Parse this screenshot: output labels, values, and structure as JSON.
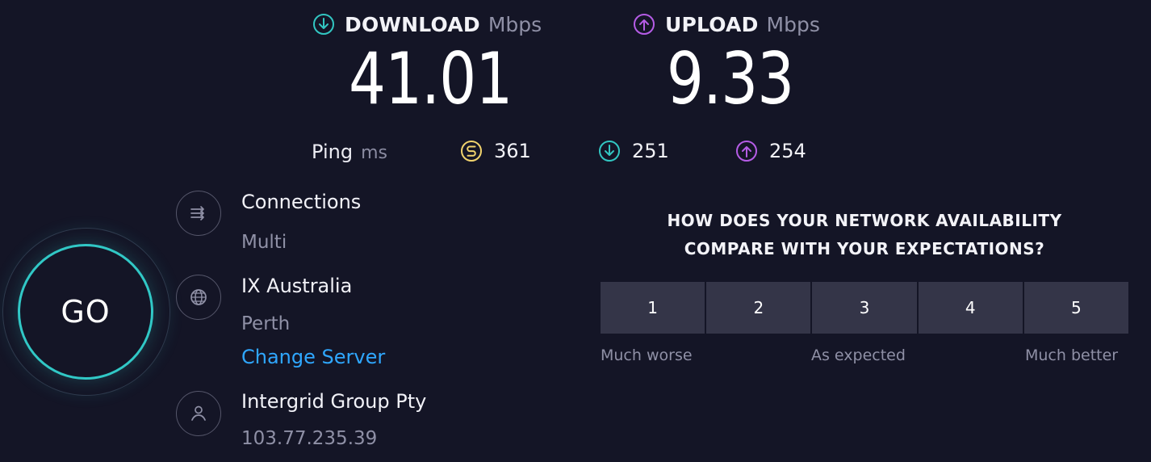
{
  "speed": {
    "download": {
      "label": "DOWNLOAD",
      "unit": "Mbps",
      "value": "41.01",
      "icon": "download-arrow-circle-icon",
      "color": "#32c6c2"
    },
    "upload": {
      "label": "UPLOAD",
      "unit": "Mbps",
      "value": "9.33",
      "icon": "upload-arrow-circle-icon",
      "color": "#b55ce6"
    }
  },
  "ping": {
    "label": "Ping",
    "unit": "ms",
    "idle": {
      "value": "361",
      "icon": "ping-idle-icon",
      "color": "#f1d36d"
    },
    "download": {
      "value": "251",
      "icon": "download-arrow-circle-icon",
      "color": "#32c6c2"
    },
    "upload": {
      "value": "254",
      "icon": "upload-arrow-circle-icon",
      "color": "#b55ce6"
    }
  },
  "go_button": {
    "label": "GO",
    "color": "#31c8c6"
  },
  "connections": {
    "title": "Connections",
    "value": "Multi",
    "icon": "connections-icon"
  },
  "server": {
    "title": "IX Australia",
    "location": "Perth",
    "change_label": "Change Server",
    "icon": "globe-icon",
    "link_color": "#2fa7ff"
  },
  "provider": {
    "name": "Intergrid Group Pty",
    "ip": "103.77.235.39",
    "icon": "user-icon"
  },
  "survey": {
    "question_line1": "HOW DOES YOUR NETWORK AVAILABILITY",
    "question_line2": "COMPARE WITH YOUR EXPECTATIONS?",
    "options": [
      "1",
      "2",
      "3",
      "4",
      "5"
    ],
    "scale_left": "Much worse",
    "scale_middle": "As expected",
    "scale_right": "Much better"
  }
}
